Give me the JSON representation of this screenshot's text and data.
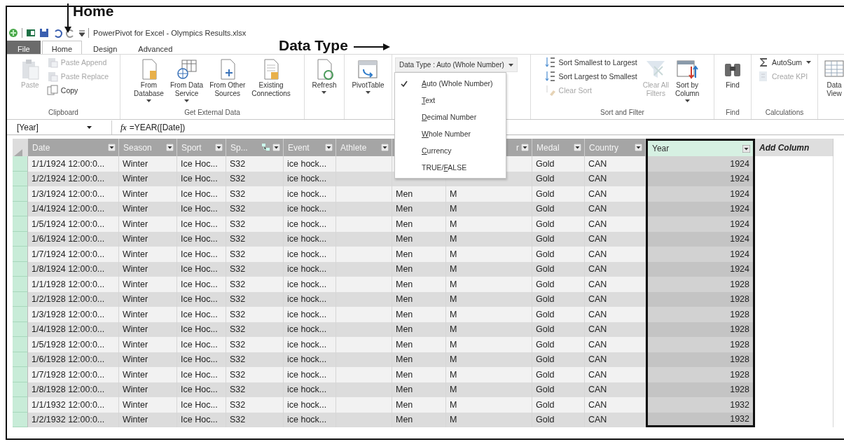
{
  "annotations": [
    {
      "kind": "down",
      "text": "Home"
    },
    {
      "kind": "right",
      "text": "Data Type"
    }
  ],
  "title_bar": {
    "title": "PowerPivot for Excel - Olympics Results.xlsx"
  },
  "tabs": [
    {
      "label": "File",
      "kind": "file",
      "selected": false
    },
    {
      "label": "Home",
      "kind": "tab",
      "selected": true
    },
    {
      "label": "Design",
      "kind": "tab",
      "selected": false
    },
    {
      "label": "Advanced",
      "kind": "tab",
      "selected": false
    }
  ],
  "ribbon": [
    {
      "label": "Clipboard",
      "buttons": [
        {
          "kind": "large",
          "lines": [
            "Paste"
          ],
          "disabled": true,
          "dropdown": false
        },
        {
          "kind": "small",
          "lines": [
            "Paste Append"
          ],
          "disabled": true,
          "dropdown": false
        },
        {
          "kind": "small",
          "lines": [
            "Paste Replace"
          ],
          "disabled": true,
          "dropdown": false
        },
        {
          "kind": "small",
          "lines": [
            "Copy"
          ],
          "disabled": false,
          "dropdown": false
        }
      ]
    },
    {
      "label": "Get External Data",
      "buttons": [
        {
          "kind": "large",
          "lines": [
            "From",
            "Database"
          ],
          "disabled": false,
          "dropdown": true
        },
        {
          "kind": "large",
          "lines": [
            "From Data",
            "Service"
          ],
          "disabled": false,
          "dropdown": true
        },
        {
          "kind": "large",
          "lines": [
            "From Other",
            "Sources"
          ],
          "disabled": false,
          "dropdown": false
        },
        {
          "kind": "large",
          "lines": [
            "Existing",
            "Connections"
          ],
          "disabled": false,
          "dropdown": false
        }
      ]
    },
    {
      "buttons": [
        {
          "kind": "large",
          "lines": [
            "Refresh"
          ],
          "disabled": false,
          "dropdown": true
        }
      ]
    },
    {
      "buttons": [
        {
          "kind": "large",
          "lines": [
            "PivotTable"
          ],
          "disabled": false,
          "dropdown": true
        }
      ]
    },
    {
      "buttons": [
        {
          "kind": "menu",
          "lines": [
            "Data Type : Auto (Whole Number)"
          ],
          "dropdown": true,
          "expanded": true,
          "items": [
            {
              "key": "A",
              "after": "uto (Whole Number)",
              "checked": true
            },
            {
              "key": "T",
              "after": "ext",
              "checked": false
            },
            {
              "key": "D",
              "after": "ecimal Number",
              "checked": false
            },
            {
              "key": "W",
              "after": "hole Number",
              "checked": false
            },
            {
              "key": "C",
              "after": "urrency",
              "checked": false
            },
            {
              "before": "TRUE/",
              "key": "F",
              "after": "ALSE",
              "checked": false
            }
          ]
        }
      ]
    },
    {
      "label": "Sort and Filter",
      "buttons": [
        {
          "kind": "small",
          "lines": [
            "Sort Smallest to Largest"
          ],
          "disabled": false,
          "dropdown": false
        },
        {
          "kind": "small",
          "lines": [
            "Sort Largest to Smallest"
          ],
          "disabled": false,
          "dropdown": false
        },
        {
          "kind": "small",
          "lines": [
            "Clear Sort"
          ],
          "disabled": true,
          "dropdown": false
        },
        {
          "kind": "large",
          "lines": [
            "Clear All",
            "Filters"
          ],
          "disabled": true,
          "dropdown": false
        },
        {
          "kind": "large",
          "lines": [
            "Sort by",
            "Column"
          ],
          "disabled": false,
          "dropdown": true
        }
      ]
    },
    {
      "label": "Find",
      "buttons": [
        {
          "kind": "large",
          "lines": [
            "Find"
          ],
          "disabled": false,
          "dropdown": false
        }
      ]
    },
    {
      "label": "Calculations",
      "buttons": [
        {
          "kind": "small",
          "lines": [
            "AutoSum"
          ],
          "disabled": false,
          "dropdown": true
        },
        {
          "kind": "small",
          "lines": [
            "Create KPI"
          ],
          "disabled": true,
          "dropdown": false
        }
      ]
    },
    {
      "buttons": [
        {
          "kind": "large",
          "lines": [
            "Data",
            "View"
          ],
          "disabled": false,
          "dropdown": false
        }
      ]
    }
  ],
  "formula_bar": {
    "name_box": "[Year]",
    "fx": "fx",
    "formula": "=YEAR([Date])"
  },
  "table": {
    "columns": [
      {
        "header": "Date",
        "kind": "data",
        "selected": false
      },
      {
        "header": "Season",
        "kind": "data",
        "selected": false
      },
      {
        "header": "Sport",
        "kind": "data",
        "selected": false
      },
      {
        "header": "Sp...",
        "kind": "linked",
        "selected": false
      },
      {
        "header": "Event",
        "kind": "data",
        "selected": false
      },
      {
        "header": "Athlete",
        "kind": "data",
        "selected": false
      },
      {
        "kind": "hidden"
      },
      {
        "header": "r",
        "kind": "cut",
        "selected": false
      },
      {
        "header": "Medal",
        "kind": "data",
        "selected": false
      },
      {
        "header": "Country",
        "kind": "data",
        "selected": false
      },
      {
        "header": "Year",
        "kind": "number",
        "selected": true
      },
      {
        "header": "Add Column",
        "kind": "add",
        "selected": false
      }
    ],
    "rows": [
      [
        "1/1/1924 12:00:0...",
        "Winter",
        "Ice Hoc...",
        "S32",
        "ice hock...",
        null,
        null,
        null,
        "Gold",
        "CAN",
        "1924",
        null
      ],
      [
        "1/2/1924 12:00:0...",
        "Winter",
        "Ice Hoc...",
        "S32",
        "ice hock...",
        null,
        null,
        null,
        "Gold",
        "CAN",
        "1924",
        null
      ],
      [
        "1/3/1924 12:00:0...",
        "Winter",
        "Ice Hoc...",
        "S32",
        "ice hock...",
        null,
        "Men",
        "M",
        "Gold",
        "CAN",
        "1924",
        null
      ],
      [
        "1/4/1924 12:00:0...",
        "Winter",
        "Ice Hoc...",
        "S32",
        "ice hock...",
        null,
        "Men",
        "M",
        "Gold",
        "CAN",
        "1924",
        null
      ],
      [
        "1/5/1924 12:00:0...",
        "Winter",
        "Ice Hoc...",
        "S32",
        "ice hock...",
        null,
        "Men",
        "M",
        "Gold",
        "CAN",
        "1924",
        null
      ],
      [
        "1/6/1924 12:00:0...",
        "Winter",
        "Ice Hoc...",
        "S32",
        "ice hock...",
        null,
        "Men",
        "M",
        "Gold",
        "CAN",
        "1924",
        null
      ],
      [
        "1/7/1924 12:00:0...",
        "Winter",
        "Ice Hoc...",
        "S32",
        "ice hock...",
        null,
        "Men",
        "M",
        "Gold",
        "CAN",
        "1924",
        null
      ],
      [
        "1/8/1924 12:00:0...",
        "Winter",
        "Ice Hoc...",
        "S32",
        "ice hock...",
        null,
        "Men",
        "M",
        "Gold",
        "CAN",
        "1924",
        null
      ],
      [
        "1/1/1928 12:00:0...",
        "Winter",
        "Ice Hoc...",
        "S32",
        "ice hock...",
        null,
        "Men",
        "M",
        "Gold",
        "CAN",
        "1928",
        null
      ],
      [
        "1/2/1928 12:00:0...",
        "Winter",
        "Ice Hoc...",
        "S32",
        "ice hock...",
        null,
        "Men",
        "M",
        "Gold",
        "CAN",
        "1928",
        null
      ],
      [
        "1/3/1928 12:00:0...",
        "Winter",
        "Ice Hoc...",
        "S32",
        "ice hock...",
        null,
        "Men",
        "M",
        "Gold",
        "CAN",
        "1928",
        null
      ],
      [
        "1/4/1928 12:00:0...",
        "Winter",
        "Ice Hoc...",
        "S32",
        "ice hock...",
        null,
        "Men",
        "M",
        "Gold",
        "CAN",
        "1928",
        null
      ],
      [
        "1/5/1928 12:00:0...",
        "Winter",
        "Ice Hoc...",
        "S32",
        "ice hock...",
        null,
        "Men",
        "M",
        "Gold",
        "CAN",
        "1928",
        null
      ],
      [
        "1/6/1928 12:00:0...",
        "Winter",
        "Ice Hoc...",
        "S32",
        "ice hock...",
        null,
        "Men",
        "M",
        "Gold",
        "CAN",
        "1928",
        null
      ],
      [
        "1/7/1928 12:00:0...",
        "Winter",
        "Ice Hoc...",
        "S32",
        "ice hock...",
        null,
        "Men",
        "M",
        "Gold",
        "CAN",
        "1928",
        null
      ],
      [
        "1/8/1928 12:00:0...",
        "Winter",
        "Ice Hoc...",
        "S32",
        "ice hock...",
        null,
        "Men",
        "M",
        "Gold",
        "CAN",
        "1928",
        null
      ],
      [
        "1/1/1932 12:00:0...",
        "Winter",
        "Ice Hoc...",
        "S32",
        "ice hock...",
        null,
        "Men",
        "M",
        "Gold",
        "CAN",
        "1932",
        null
      ],
      [
        "1/2/1932 12:00:0...",
        "Winter",
        "Ice Hoc...",
        "S32",
        "ice hock...",
        null,
        "Men",
        "M",
        "Gold",
        "CAN",
        "1932",
        null
      ]
    ]
  }
}
